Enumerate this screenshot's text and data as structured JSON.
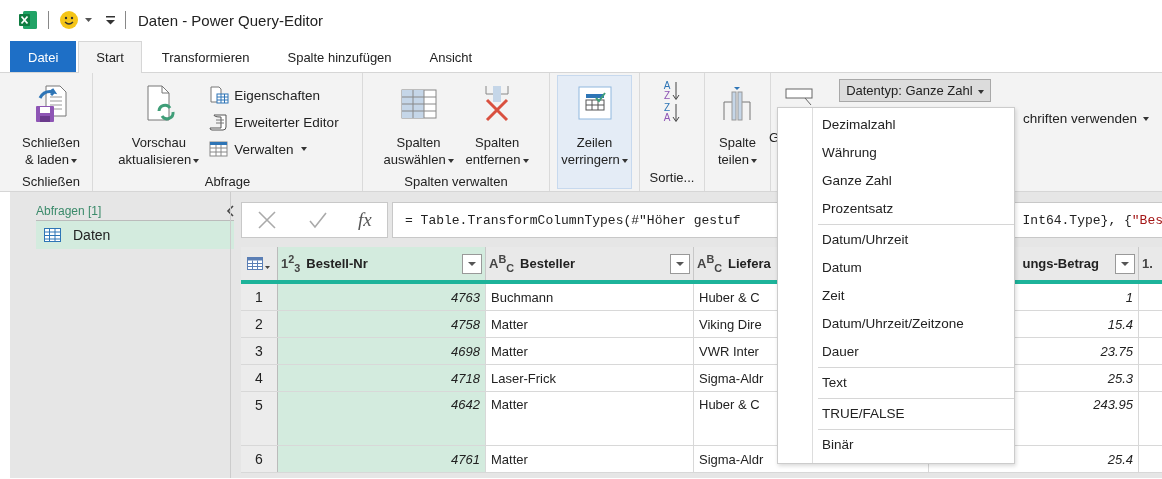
{
  "window": {
    "title": "Daten - Power Query-Editor"
  },
  "tabs": [
    {
      "label": "Datei",
      "kind": "file",
      "selected": false
    },
    {
      "label": "Start",
      "kind": "tab",
      "selected": true
    },
    {
      "label": "Transformieren",
      "kind": "tab",
      "selected": false
    },
    {
      "label": "Spalte hinzufügen",
      "kind": "tab",
      "selected": false
    },
    {
      "label": "Ansicht",
      "kind": "tab",
      "selected": false
    }
  ],
  "ribbon": {
    "groups": [
      {
        "label": "Schließen",
        "large": [
          {
            "lines": [
              "Schließen",
              "& laden"
            ],
            "dropdown": true,
            "pressed": false
          }
        ]
      },
      {
        "label": "Abfrage",
        "large": [
          {
            "lines": [
              "Vorschau",
              "aktualisieren"
            ],
            "dropdown": true,
            "pressed": false
          }
        ],
        "small": [
          {
            "label": "Eigenschaften",
            "dropdown": false
          },
          {
            "label": "Erweiterter Editor",
            "dropdown": false
          },
          {
            "label": "Verwalten",
            "dropdown": true
          }
        ]
      },
      {
        "label": "Spalten verwalten",
        "large": [
          {
            "lines": [
              "Spalten",
              "auswählen"
            ],
            "dropdown": true,
            "pressed": false
          },
          {
            "lines": [
              "Spalten",
              "entfernen"
            ],
            "dropdown": true,
            "pressed": false
          }
        ]
      },
      {
        "large": [
          {
            "lines": [
              "Zeilen",
              "verringern"
            ],
            "dropdown": true,
            "pressed": true
          }
        ]
      },
      {
        "label": "Sortie...",
        "sort_icons": [
          [
            "A",
            "Z"
          ],
          [
            "Z",
            "A"
          ]
        ]
      },
      {
        "large": [
          {
            "lines": [
              "Spalte",
              "teilen"
            ],
            "dropdown": true,
            "pressed": false
          }
        ]
      }
    ],
    "cut_button": "G",
    "datatype": {
      "label": "Datentyp: Ganze Zahl",
      "expanded": true
    },
    "cut_item": {
      "label": "chriften verwenden",
      "dropdown": true
    }
  },
  "datatype_menu": {
    "sections": [
      [
        "Dezimalzahl",
        "Währung",
        "Ganze Zahl",
        "Prozentsatz"
      ],
      [
        "Datum/Uhrzeit",
        "Datum",
        "Zeit",
        "Datum/Uhrzeit/Zeitzone",
        "Dauer"
      ],
      [
        "Text"
      ],
      [
        "TRUE/FALSE"
      ],
      [
        "Binär"
      ]
    ]
  },
  "queries": {
    "title": "Abfragen [1]",
    "items": [
      {
        "label": "Daten",
        "selected": true
      }
    ]
  },
  "formula": {
    "fx": "fx",
    "left": "= Table.TransformColumnTypes(#\"Höher gestuf",
    "right": "Int64.Type}, {",
    "right_string": "\"Bes"
  },
  "table": {
    "columns": [
      {
        "type": "1$^{2}$$_{3}$",
        "name": "Bestell-Nr",
        "selected": true
      },
      {
        "type": "A$^{B}$$_{C}$",
        "name": "Besteller",
        "selected": false
      },
      {
        "type": "A$^{B}$$_{C}$",
        "name": "Liefera",
        "selected": false
      },
      {
        "name": "ungs-Betrag",
        "selected": false
      },
      {
        "type": "1.",
        "selected": false
      }
    ],
    "rows": [
      {
        "n": "1",
        "tall": false,
        "cells": [
          "4763",
          "Buchmann",
          "Huber & C",
          "1"
        ]
      },
      {
        "n": "2",
        "tall": false,
        "cells": [
          "4758",
          "Matter",
          "Viking Dire",
          "15.4"
        ]
      },
      {
        "n": "3",
        "tall": false,
        "cells": [
          "4698",
          "Matter",
          "VWR Inter",
          "23.75"
        ]
      },
      {
        "n": "4",
        "tall": false,
        "cells": [
          "4718",
          "Laser-Frick",
          "Sigma-Aldr",
          "25.3"
        ]
      },
      {
        "n": "5",
        "tall": true,
        "cells": [
          "4642",
          "Matter",
          "Huber & C",
          "243.95"
        ]
      },
      {
        "n": "6",
        "tall": false,
        "cells": [
          "4761",
          "Matter",
          "Sigma-Aldr",
          "25.4"
        ]
      }
    ]
  }
}
